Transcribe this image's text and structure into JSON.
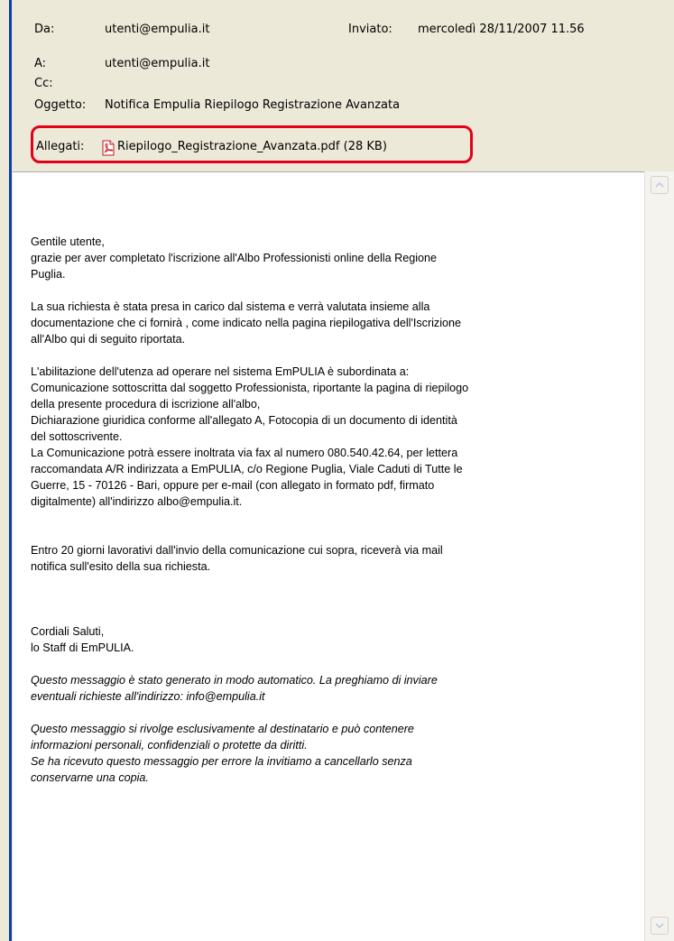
{
  "header": {
    "from_label": "Da:",
    "from_value": "utenti@empulia.it",
    "sent_label": "Inviato:",
    "sent_value": "mercoledì 28/11/2007 11.56",
    "to_label": "A:",
    "to_value": "utenti@empulia.it",
    "cc_label": "Cc:",
    "subject_label": "Oggetto:",
    "subject_value": "Notifica Empulia Riepilogo Registrazione Avanzata",
    "attachments_label": "Allegati:",
    "attachment_name": "Riepilogo_Registrazione_Avanzata.pdf (28 KB)"
  },
  "message": {
    "p1": "Gentile utente,\ngrazie per aver completato l'iscrizione all'Albo Professionisti online della Regione\nPuglia.",
    "p2": "La sua richiesta è stata presa in carico dal sistema e verrà valutata insieme alla\ndocumentazione che ci fornirà , come indicato nella pagina riepilogativa dell'Iscrizione\nall'Albo qui di seguito riportata.",
    "p3": "L'abilitazione dell'utenza ad operare nel sistema EmPULIA è subordinata a:\nComunicazione sottoscritta dal soggetto Professionista, riportante la pagina di riepilogo\ndella presente procedura di iscrizione all'albo,\nDichiarazione giuridica conforme all'allegato A, Fotocopia di un documento di identità\ndel sottoscrivente.\nLa Comunicazione potrà essere inoltrata via fax al numero 080.540.42.64, per lettera\nraccomandata A/R indirizzata a EmPULIA, c/o Regione Puglia, Viale Caduti di Tutte le\nGuerre, 15 - 70126 - Bari, oppure per e-mail (con allegato in formato pdf, firmato\ndigitalmente) all'indirizzo albo@empulia.it.",
    "p4": "Entro 20 giorni lavorativi dall'invio della comunicazione cui sopra, riceverà via mail\nnotifica sull'esito della sua richiesta.",
    "p5": "Cordiali Saluti,\nlo Staff di EmPULIA.",
    "p6": "Questo messaggio è stato generato in modo automatico. La preghiamo di inviare\neventuali richieste all'indirizzo: info@empulia.it",
    "p7": "Questo messaggio si rivolge esclusivamente al destinatario e può contenere\ninformazioni personali, confidenziali o protette da diritti.\nSe ha ricevuto questo messaggio per errore la invitiamo a cancellarlo senza\nconservarne una copia."
  },
  "icons": {
    "attachment": "pdf-icon",
    "scroll_up": "chevron-up-icon",
    "scroll_down": "chevron-down-icon"
  },
  "colors": {
    "highlight": "#e3001b",
    "header_bg": "#ece9d8",
    "window_edge": "#0a3ea8"
  }
}
